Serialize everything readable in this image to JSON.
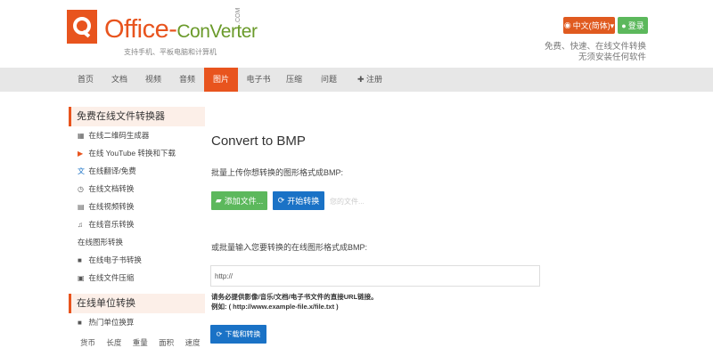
{
  "header": {
    "logo_text": "Office-",
    "logo_conv": "ConVerter",
    "logo_com": ".COM",
    "logo_sub": "支持手机、平板电脑和计算机",
    "lang_label": "中文(简体)▾",
    "login_label": "登录",
    "tagline1": "免费、快速、在线文件转换",
    "tagline2": "无须安装任何软件",
    "accent": "#e8541e"
  },
  "nav": {
    "items": [
      "首页",
      "文档",
      "视频",
      "音频",
      "图片",
      "电子书",
      "压缩",
      "问题",
      "注册"
    ]
  },
  "sidebar": {
    "section1_title": "免费在线文件转换器",
    "items": [
      {
        "icon": "▦",
        "label": "在线二维码生成器"
      },
      {
        "icon": "▶",
        "label": "在线 YouTube 转换和下载"
      },
      {
        "icon": "文",
        "label": "在线翻译/免费"
      },
      {
        "icon": "◷",
        "label": "在线文档转换"
      },
      {
        "icon": "▤",
        "label": "在线视频转换"
      },
      {
        "icon": "♫",
        "label": "在线音乐转换"
      },
      {
        "icon": "",
        "label": "在线图形转换"
      },
      {
        "icon": "■",
        "label": "在线电子书转换"
      },
      {
        "icon": "▣",
        "label": "在线文件压缩"
      }
    ],
    "section2_title": "在线单位转换",
    "unit_item": {
      "icon": "■",
      "label": "热门单位换算"
    },
    "unit_sub": [
      "货币",
      "长度",
      "重量",
      "面积",
      "速度"
    ]
  },
  "main": {
    "title": "Convert to BMP",
    "desc1": "批量上传你想转换的图形格式成BMP:",
    "add_label": "添加文件...",
    "start_label": "开始转换",
    "no_file": "您的文件...",
    "desc2": "或批量输入您要转换的在线图形格式成BMP:",
    "url_value": "http://",
    "hint1": "请务必提供影像/音乐/文档/电子书文件的直接URL链接。",
    "hint2": "例如: ( http://www.example-file.x/file.txt )",
    "download_label": "下载和转换"
  }
}
